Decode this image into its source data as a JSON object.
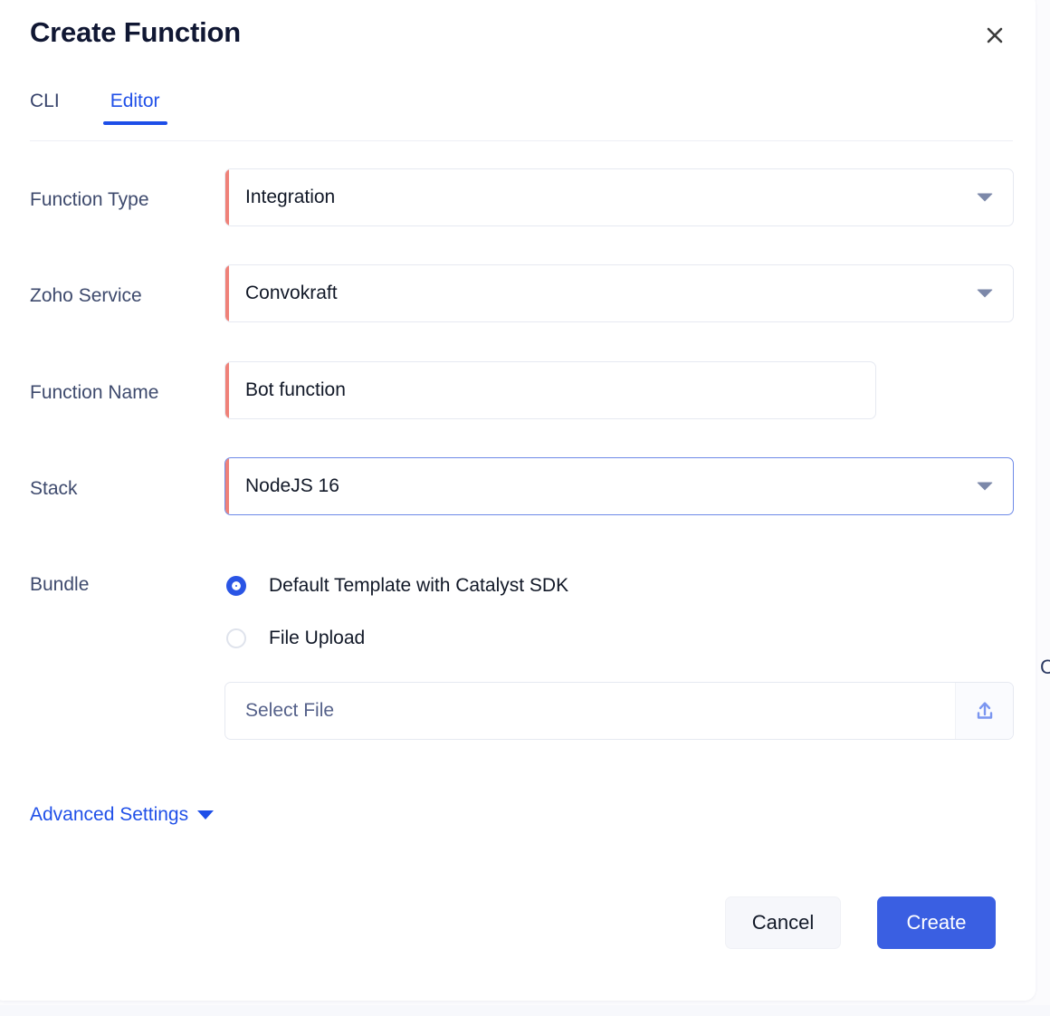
{
  "modal": {
    "title": "Create Function",
    "close_icon": "close-icon"
  },
  "tabs": [
    {
      "label": "CLI",
      "active": false
    },
    {
      "label": "Editor",
      "active": true
    }
  ],
  "fields": {
    "function_type": {
      "label": "Function Type",
      "value": "Integration",
      "control": "select",
      "required": true,
      "focused": false,
      "icon": "chevron-down-icon"
    },
    "zoho_service": {
      "label": "Zoho Service",
      "value": "Convokraft",
      "control": "select",
      "required": true,
      "focused": false,
      "icon": "chevron-down-icon"
    },
    "function_name": {
      "label": "Function Name",
      "value": "Bot function",
      "control": "text",
      "required": true,
      "focused": false
    },
    "stack": {
      "label": "Stack",
      "value": "NodeJS 16",
      "control": "select",
      "required": true,
      "focused": true,
      "icon": "chevron-down-icon"
    },
    "bundle": {
      "label": "Bundle",
      "options": [
        {
          "label": "Default Template with Catalyst SDK",
          "selected": true
        },
        {
          "label": "File Upload",
          "selected": false
        }
      ],
      "file_picker": {
        "placeholder": "Select File",
        "value": "",
        "icon": "upload-icon"
      }
    }
  },
  "advanced_settings": {
    "label": "Advanced Settings",
    "icon": "chevron-down-icon",
    "expanded": false
  },
  "footer": {
    "cancel_label": "Cancel",
    "create_label": "Create"
  },
  "background": {
    "edge_fragment": "C"
  },
  "colors": {
    "accent_blue": "#2050e8",
    "primary_button": "#3a5fe2",
    "required_bar": "#ef8178",
    "label_text": "#3e4a6d",
    "title_text": "#101733",
    "focus_border": "#6e8ae8",
    "chevron": "#7c88a9",
    "upload_icon": "#7b96f0"
  }
}
